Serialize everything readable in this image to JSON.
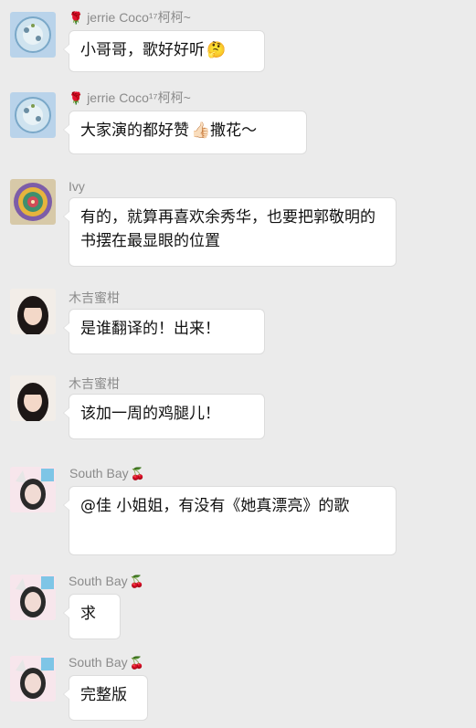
{
  "messages": [
    {
      "sender": "jerrie Coco¹⁷柯柯~",
      "text": "小哥哥，歌好好听",
      "emoji": "🤔",
      "avatar": "planet-avatar"
    },
    {
      "sender": "jerrie Coco¹⁷柯柯~",
      "text": "大家演的都好赞",
      "emoji": "👍🏻",
      "text_after": "撒花～",
      "avatar": "planet-avatar"
    },
    {
      "sender": "Ivy",
      "text": "有的，就算再喜欢余秀华，也要把郭敬明的书摆在最显眼的位置",
      "avatar": "mandala-avatar"
    },
    {
      "sender": "木吉蜜柑",
      "text": "是谁翻译的！出来！",
      "avatar": "girl-avatar"
    },
    {
      "sender": "木吉蜜柑",
      "text": "该加一周的鸡腿儿！",
      "avatar": "girl-avatar"
    },
    {
      "sender": "South Bay",
      "text": "@佳 小姐姐，有没有《她真漂亮》的歌",
      "avatar": "cat-ear-avatar"
    },
    {
      "sender": "South Bay",
      "text": "求",
      "avatar": "cat-ear-avatar"
    },
    {
      "sender": "South Bay",
      "text": "完整版",
      "avatar": "cat-ear-avatar"
    }
  ],
  "icons": {
    "rose": "🌹",
    "cherry": "🍒"
  }
}
